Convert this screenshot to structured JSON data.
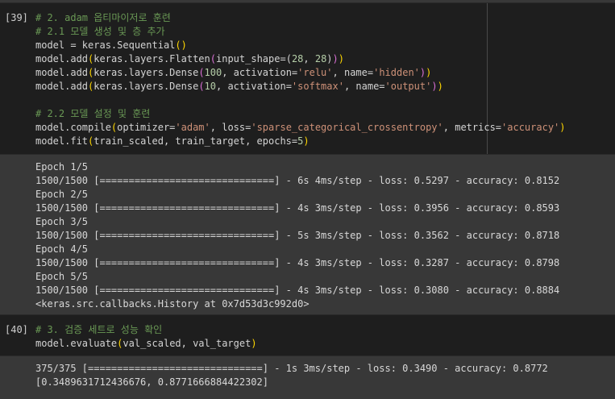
{
  "cells": [
    {
      "prompt": "[39]",
      "code": [
        [
          {
            "t": "# 2. adam 옵티마이저로 훈련",
            "c": "comment"
          }
        ],
        [
          {
            "t": "# 2.1 모델 생성 및 층 추가",
            "c": "comment"
          }
        ],
        [
          {
            "t": "model = keras.Sequential",
            "c": "plain"
          },
          {
            "t": "(",
            "c": "paren3"
          },
          {
            "t": ")",
            "c": "paren3"
          }
        ],
        [
          {
            "t": "model.add",
            "c": "plain"
          },
          {
            "t": "(",
            "c": "paren3"
          },
          {
            "t": "keras.layers.Flatten",
            "c": "plain"
          },
          {
            "t": "(",
            "c": "paren2"
          },
          {
            "t": "input_shape=",
            "c": "plain"
          },
          {
            "t": "(",
            "c": "paren"
          },
          {
            "t": "28",
            "c": "num"
          },
          {
            "t": ", ",
            "c": "plain"
          },
          {
            "t": "28",
            "c": "num"
          },
          {
            "t": ")",
            "c": "paren"
          },
          {
            "t": ")",
            "c": "paren2"
          },
          {
            "t": ")",
            "c": "paren3"
          }
        ],
        [
          {
            "t": "model.add",
            "c": "plain"
          },
          {
            "t": "(",
            "c": "paren3"
          },
          {
            "t": "keras.layers.Dense",
            "c": "plain"
          },
          {
            "t": "(",
            "c": "paren2"
          },
          {
            "t": "100",
            "c": "num"
          },
          {
            "t": ", activation=",
            "c": "plain"
          },
          {
            "t": "'relu'",
            "c": "str"
          },
          {
            "t": ", name=",
            "c": "plain"
          },
          {
            "t": "'hidden'",
            "c": "str"
          },
          {
            "t": ")",
            "c": "paren2"
          },
          {
            "t": ")",
            "c": "paren3"
          }
        ],
        [
          {
            "t": "model.add",
            "c": "plain"
          },
          {
            "t": "(",
            "c": "paren3"
          },
          {
            "t": "keras.layers.Dense",
            "c": "plain"
          },
          {
            "t": "(",
            "c": "paren2"
          },
          {
            "t": "10",
            "c": "num"
          },
          {
            "t": ", activation=",
            "c": "plain"
          },
          {
            "t": "'softmax'",
            "c": "str"
          },
          {
            "t": ", name=",
            "c": "plain"
          },
          {
            "t": "'output'",
            "c": "str"
          },
          {
            "t": ")",
            "c": "paren2"
          },
          {
            "t": ")",
            "c": "paren3"
          }
        ],
        [],
        [
          {
            "t": "# 2.2 모델 설정 및 훈련",
            "c": "comment"
          }
        ],
        [
          {
            "t": "model.compile",
            "c": "plain"
          },
          {
            "t": "(",
            "c": "paren3"
          },
          {
            "t": "optimizer=",
            "c": "plain"
          },
          {
            "t": "'adam'",
            "c": "str"
          },
          {
            "t": ", loss=",
            "c": "plain"
          },
          {
            "t": "'sparse_categorical_crossentropy'",
            "c": "str"
          },
          {
            "t": ", metrics=",
            "c": "plain"
          },
          {
            "t": "'accuracy'",
            "c": "str"
          },
          {
            "t": ")",
            "c": "paren3"
          }
        ],
        [
          {
            "t": "model.fit",
            "c": "plain"
          },
          {
            "t": "(",
            "c": "paren3"
          },
          {
            "t": "train_scaled, train_target, epochs=",
            "c": "plain"
          },
          {
            "t": "5",
            "c": "num"
          },
          {
            "t": ")",
            "c": "paren3"
          }
        ]
      ],
      "output": [
        "Epoch 1/5",
        "1500/1500 [==============================] - 6s 4ms/step - loss: 0.5297 - accuracy: 0.8152",
        "Epoch 2/5",
        "1500/1500 [==============================] - 4s 3ms/step - loss: 0.3956 - accuracy: 0.8593",
        "Epoch 3/5",
        "1500/1500 [==============================] - 5s 3ms/step - loss: 0.3562 - accuracy: 0.8718",
        "Epoch 4/5",
        "1500/1500 [==============================] - 4s 3ms/step - loss: 0.3287 - accuracy: 0.8798",
        "Epoch 5/5",
        "1500/1500 [==============================] - 4s 3ms/step - loss: 0.3080 - accuracy: 0.8884",
        "<keras.src.callbacks.History at 0x7d53d3c992d0>"
      ]
    },
    {
      "prompt": "[40]",
      "code": [
        [
          {
            "t": "# 3. 검증 세트로 성능 확인",
            "c": "comment"
          }
        ],
        [
          {
            "t": "model.evaluate",
            "c": "plain"
          },
          {
            "t": "(",
            "c": "paren3"
          },
          {
            "t": "val_scaled, val_target",
            "c": "plain"
          },
          {
            "t": ")",
            "c": "paren3"
          }
        ]
      ],
      "output": [
        "375/375 [==============================] - 1s 3ms/step - loss: 0.3490 - accuracy: 0.8772",
        "[0.3489631712436676, 0.8771666884422302]"
      ]
    }
  ]
}
